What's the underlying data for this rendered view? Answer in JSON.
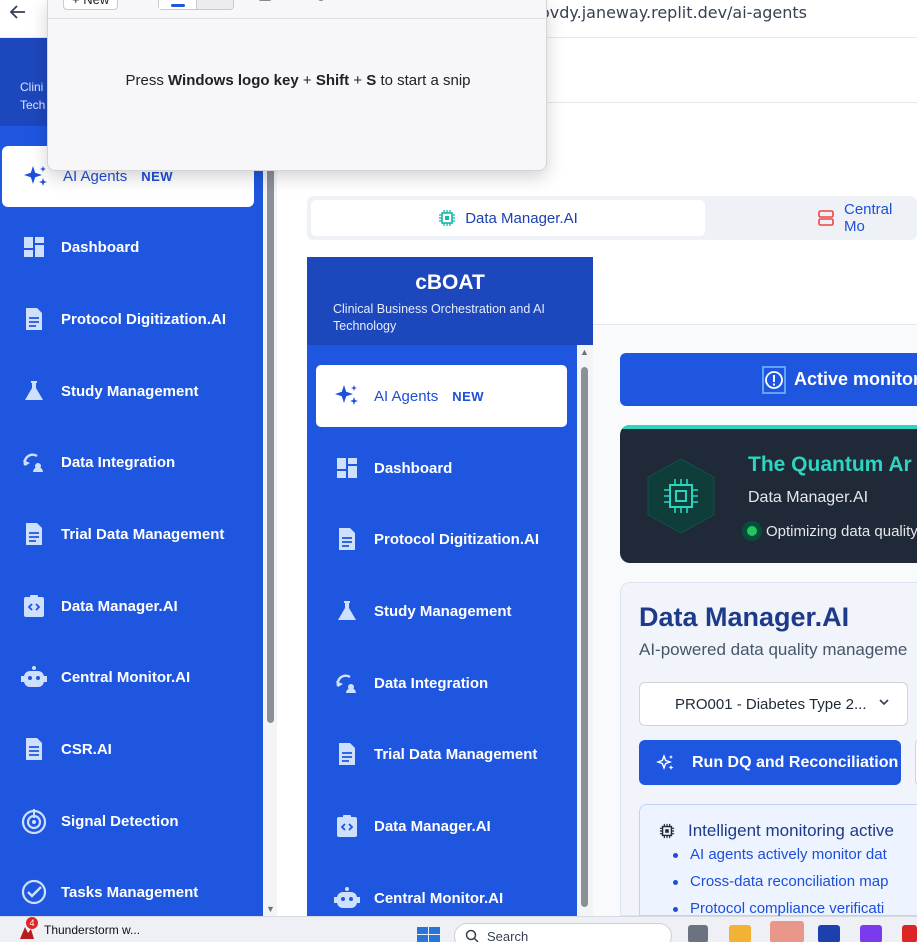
{
  "browser": {
    "url_fragment": "ovdy.janeway.replit.dev/ai-agents"
  },
  "snip_tool": {
    "new_button": "+ New",
    "message_prefix": "Press ",
    "key1": "Windows logo key",
    "plus1": " + ",
    "key2": "Shift",
    "plus2": " + ",
    "key3": "S",
    "message_suffix": " to start a snip"
  },
  "outer_sidebar": {
    "brand_line1": "Clini",
    "brand_line2": "Tech",
    "items": [
      {
        "label": "AI Agents",
        "badge": "NEW",
        "icon": "sparkles-icon"
      },
      {
        "label": "Dashboard",
        "icon": "dashboard-icon"
      },
      {
        "label": "Protocol Digitization.AI",
        "icon": "document-icon"
      },
      {
        "label": "Study Management",
        "icon": "flask-icon"
      },
      {
        "label": "Data Integration",
        "icon": "sync-icon"
      },
      {
        "label": "Trial Data Management",
        "icon": "document-icon"
      },
      {
        "label": "Data Manager.AI",
        "icon": "code-clipboard-icon"
      },
      {
        "label": "Central Monitor.AI",
        "icon": "robot-icon"
      },
      {
        "label": "CSR.AI",
        "icon": "report-icon"
      },
      {
        "label": "Signal Detection",
        "icon": "signal-icon"
      },
      {
        "label": "Tasks Management",
        "icon": "check-circle-icon"
      }
    ]
  },
  "tabs": {
    "active": "Data Manager.AI",
    "second": "Central Mo"
  },
  "inner_app": {
    "brand_title": "cBOAT",
    "brand_subtitle": "Clinical Business Orchestration and AI Technology",
    "items": [
      {
        "label": "AI Agents",
        "badge": "NEW",
        "icon": "sparkles-icon"
      },
      {
        "label": "Dashboard",
        "icon": "dashboard-icon"
      },
      {
        "label": "Protocol Digitization.AI",
        "icon": "document-icon"
      },
      {
        "label": "Study Management",
        "icon": "flask-icon"
      },
      {
        "label": "Data Integration",
        "icon": "sync-icon"
      },
      {
        "label": "Trial Data Management",
        "icon": "document-icon"
      },
      {
        "label": "Data Manager.AI",
        "icon": "code-clipboard-icon"
      },
      {
        "label": "Central Monitor.AI",
        "icon": "robot-icon"
      }
    ]
  },
  "content": {
    "monitor_bar": "Active monitor",
    "quantum_title": "The Quantum Ar",
    "quantum_sub": "Data Manager.AI",
    "quantum_status": "Optimizing data quality",
    "dm_title": "Data Manager.AI",
    "dm_subtitle": "AI-powered data quality manageme",
    "protocol_select": "PRO001 - Diabetes Type 2...",
    "run_button": "Run DQ and Reconciliation",
    "intel_title": "Intelligent monitoring active",
    "intel_bullets": [
      "AI agents actively monitor dat",
      "Cross-data reconciliation map",
      "Protocol compliance verificati"
    ]
  },
  "taskbar": {
    "app_label": "Thunderstorm w...",
    "app_badge": "4",
    "search_placeholder": "Search"
  },
  "colors": {
    "sidebar_blue": "#1e56e0",
    "brand_dark": "#1d47bd",
    "teal_accent": "#2dd4bf"
  }
}
